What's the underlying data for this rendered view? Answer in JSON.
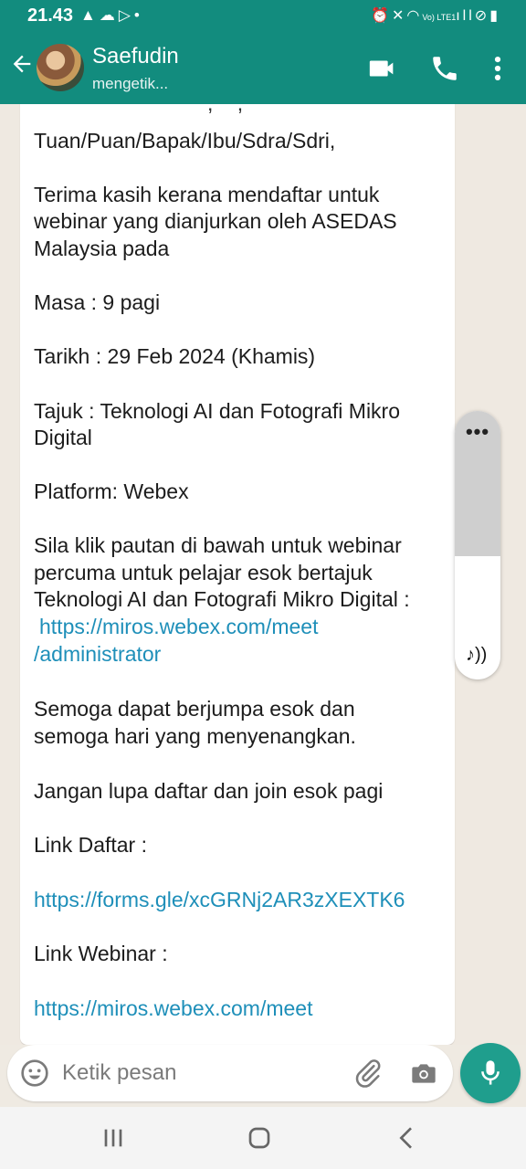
{
  "status_bar": {
    "time": "21.43",
    "left_icons": [
      "alert-icon",
      "cloud-icon",
      "play-icon",
      "dot-icon"
    ],
    "right_icons": [
      "alarm-icon",
      "mute-icon",
      "wifi-icon",
      "signal-icon",
      "dnd-icon",
      "battery-icon"
    ],
    "network_label": "Vo) LTE1"
  },
  "header": {
    "contact_name": "Saefudin",
    "contact_status": "mengetik...",
    "icons": [
      "back-arrow-icon",
      "avatar",
      "video-call-icon",
      "phone-icon",
      "more-vert-icon"
    ]
  },
  "message": {
    "lines": [
      "Tuan/Puan/Bapak/Ibu/Sdra/Sdri,",
      "Terima kasih kerana mendaftar untuk",
      "webinar yang dianjurkan oleh ASEDAS",
      "Malaysia pada",
      "Masa : 9 pagi",
      "Tarikh : 29 Feb 2024 (Khamis)",
      "Tajuk : Teknologi AI dan Fotografi Mikro",
      "Digital",
      "Platform: Webex",
      "Sila klik pautan di bawah untuk webinar",
      "percuma untuk pelajar esok bertajuk",
      "Teknologi AI dan Fotografi Mikro Digital :",
      "https://miros.webex.com/meet",
      "/administrator",
      "Semoga dapat berjumpa esok dan",
      "semoga hari yang menyenangkan.",
      "Jangan lupa daftar dan join esok pagi",
      "Link Daftar :",
      "https://forms.gle/xcGRNj2AR3zXEXTK6",
      "Link Webinar :",
      "https://miros.webex.com/meet"
    ],
    "link_indices": [
      12,
      13,
      18,
      20
    ]
  },
  "volume_panel": {
    "icons": [
      "more-horiz-icon",
      "media-volume-icon"
    ],
    "level": 0.54
  },
  "composer": {
    "placeholder": "Ketik pesan",
    "icons": [
      "emoji-icon",
      "attach-icon",
      "camera-icon",
      "mic-icon"
    ]
  },
  "nav_bar": {
    "icons": [
      "recent-apps-icon",
      "home-icon",
      "back-icon"
    ]
  },
  "colors": {
    "header": "#128c7e",
    "mic_button": "#1f9e8d",
    "link": "#1e8fb9",
    "chat_background": "#efe9e1"
  }
}
